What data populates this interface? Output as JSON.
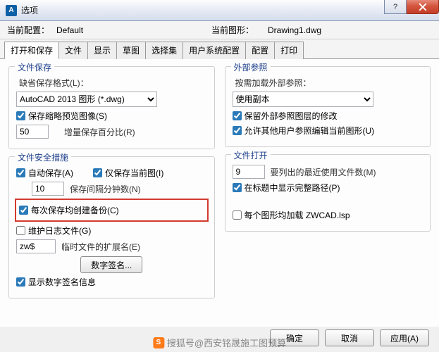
{
  "window": {
    "title": "选项",
    "icon_label": "A"
  },
  "toprow": {
    "current_config_label": "当前配置：",
    "current_config_value": "Default",
    "current_drawing_label": "当前图形：",
    "current_drawing_value": "Drawing1.dwg"
  },
  "tabs": [
    "打开和保存",
    "文件",
    "显示",
    "草图",
    "选择集",
    "用户系统配置",
    "配置",
    "打印"
  ],
  "left": {
    "save": {
      "title": "文件保存",
      "format_label": "缺省保存格式(L)：",
      "format_value": "AutoCAD 2013 图形 (*.dwg)",
      "thumbnail_label": "保存缩略预览图像(S)",
      "thumbnail_checked": true,
      "increment_value": "50",
      "increment_label": "增量保存百分比(R)"
    },
    "safety": {
      "title": "文件安全措施",
      "autosave_label": "自动保存(A)",
      "autosave_checked": true,
      "only_current_label": "仅保存当前图(I)",
      "only_current_checked": true,
      "interval_value": "10",
      "interval_label": "保存间隔分钟数(N)",
      "backup_each_label": "每次保存均创建备份(C)",
      "backup_each_checked": true,
      "log_label": "维护日志文件(G)",
      "log_checked": false,
      "temp_ext_value": "zw$",
      "temp_ext_label": "临时文件的扩展名(E)",
      "sign_button": "数字签名...",
      "show_sign_label": "显示数字签名信息",
      "show_sign_checked": true
    }
  },
  "right": {
    "xref": {
      "title": "外部参照",
      "load_label": "按需加载外部参照：",
      "load_value": "使用副本",
      "keep_layer_label": "保留外部参照图层的修改",
      "keep_layer_checked": true,
      "allow_edit_label": "允许其他用户参照编辑当前图形(U)",
      "allow_edit_checked": true
    },
    "open": {
      "title": "文件打开",
      "recent_value": "9",
      "recent_label": "要列出的最近使用文件数(M)",
      "fullpath_label": "在标题中显示完整路径(P)",
      "fullpath_checked": true,
      "load_zwcad_label": "每个图形均加载 ZWCAD.lsp",
      "load_zwcad_checked": false
    }
  },
  "footer": {
    "ok": "确定",
    "cancel": "取消",
    "apply": "应用(A)"
  },
  "watermark": {
    "icon": "S",
    "text": "搜狐号@西安铭晟施工图预算"
  }
}
